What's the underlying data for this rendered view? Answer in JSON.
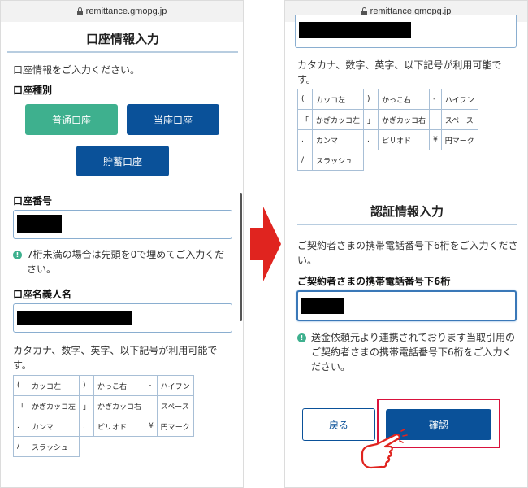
{
  "left": {
    "url": "remittance.gmopg.jp",
    "title": "口座情報入力",
    "intro": "口座情報をご入力ください。",
    "account_type_label": "口座種別",
    "buttons": {
      "ordinary": "普通口座",
      "checking": "当座口座",
      "savings": "貯蓄口座"
    },
    "account_number_label": "口座番号",
    "account_number_note": "7桁未満の場合は先頭を0で埋めてご入力ください。",
    "account_name_label": "口座名義人名",
    "chars_note": "カタカナ、数字、英字、以下記号が利用可能です。",
    "symbols": [
      [
        "(",
        "カッコ左",
        ")",
        "かっこ右",
        "-",
        "ハイフン"
      ],
      [
        "「",
        "かぎカッコ左",
        "」",
        "かぎカッコ右",
        "",
        "スペース"
      ],
      [
        ".",
        "カンマ",
        ".",
        "ピリオド",
        "¥",
        "円マーク"
      ],
      [
        "/",
        "スラッシュ"
      ]
    ]
  },
  "right": {
    "url": "remittance.gmopg.jp",
    "chars_note": "カタカナ、数字、英字、以下記号が利用可能です。",
    "symbols": [
      [
        "(",
        "カッコ左",
        ")",
        "かっこ右",
        "-",
        "ハイフン"
      ],
      [
        "「",
        "かぎカッコ左",
        "」",
        "かぎカッコ右",
        "",
        "スペース"
      ],
      [
        ".",
        "カンマ",
        ".",
        "ピリオド",
        "¥",
        "円マーク"
      ],
      [
        "/",
        "スラッシュ"
      ]
    ],
    "auth_title": "認証情報入力",
    "auth_intro": "ご契約者さまの携帯電話番号下6桁をご入力ください。",
    "phone_label": "ご契約者さまの携帯電話番号下6桁",
    "phone_note": "送金依頼元より連携されております当取引用のご契約者さまの携帯電話番号下6桁をご入力ください。",
    "back_button": "戻る",
    "confirm_button": "確認"
  },
  "colors": {
    "green": "#3eb08e",
    "blue": "#0a5199",
    "red": "#e0241f",
    "highlight": "#d9123c"
  },
  "icons": [
    "lock-icon",
    "info-icon",
    "arrow-right-icon",
    "pointing-hand-icon"
  ]
}
